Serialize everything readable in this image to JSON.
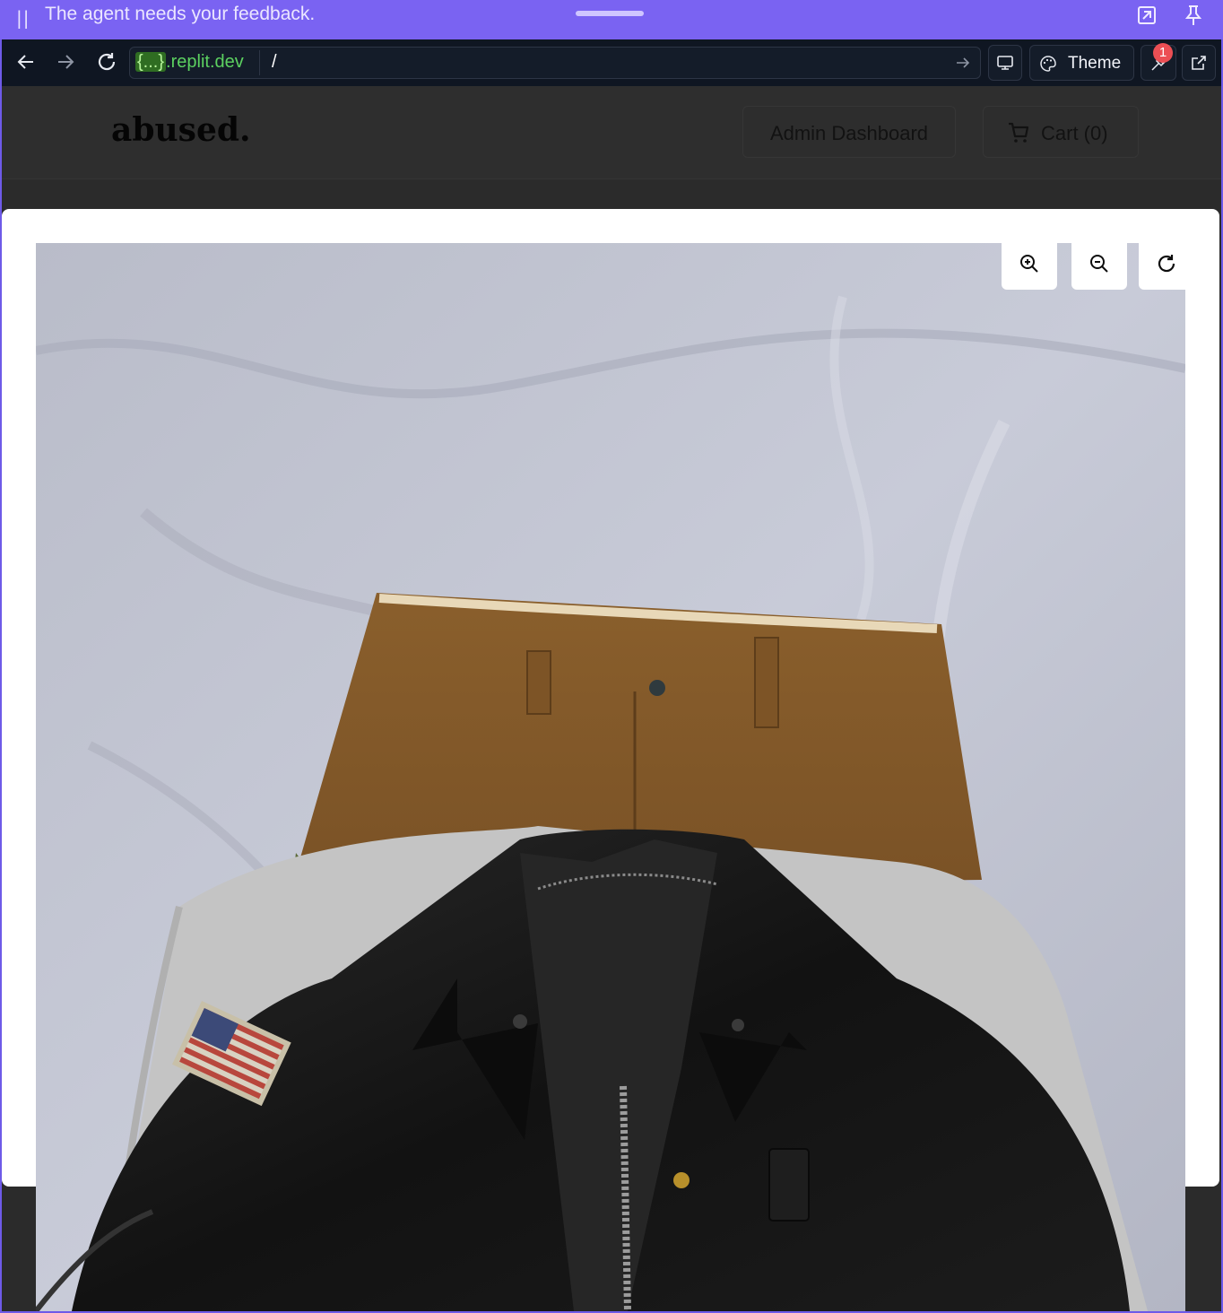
{
  "feedback_bar": {
    "message": "The agent needs your feedback."
  },
  "browser": {
    "url_host_brace": "{...}",
    "url_host_rest": ".replit.dev",
    "url_path": "/",
    "theme_label": "Theme",
    "notification_count": "1"
  },
  "site": {
    "logo": "abused.",
    "admin_button": "Admin Dashboard",
    "cart_button": "Cart (0)"
  },
  "colors": {
    "accent": "#7a63f2",
    "url_green": "#5cd160",
    "badge_red": "#ec4f54"
  }
}
